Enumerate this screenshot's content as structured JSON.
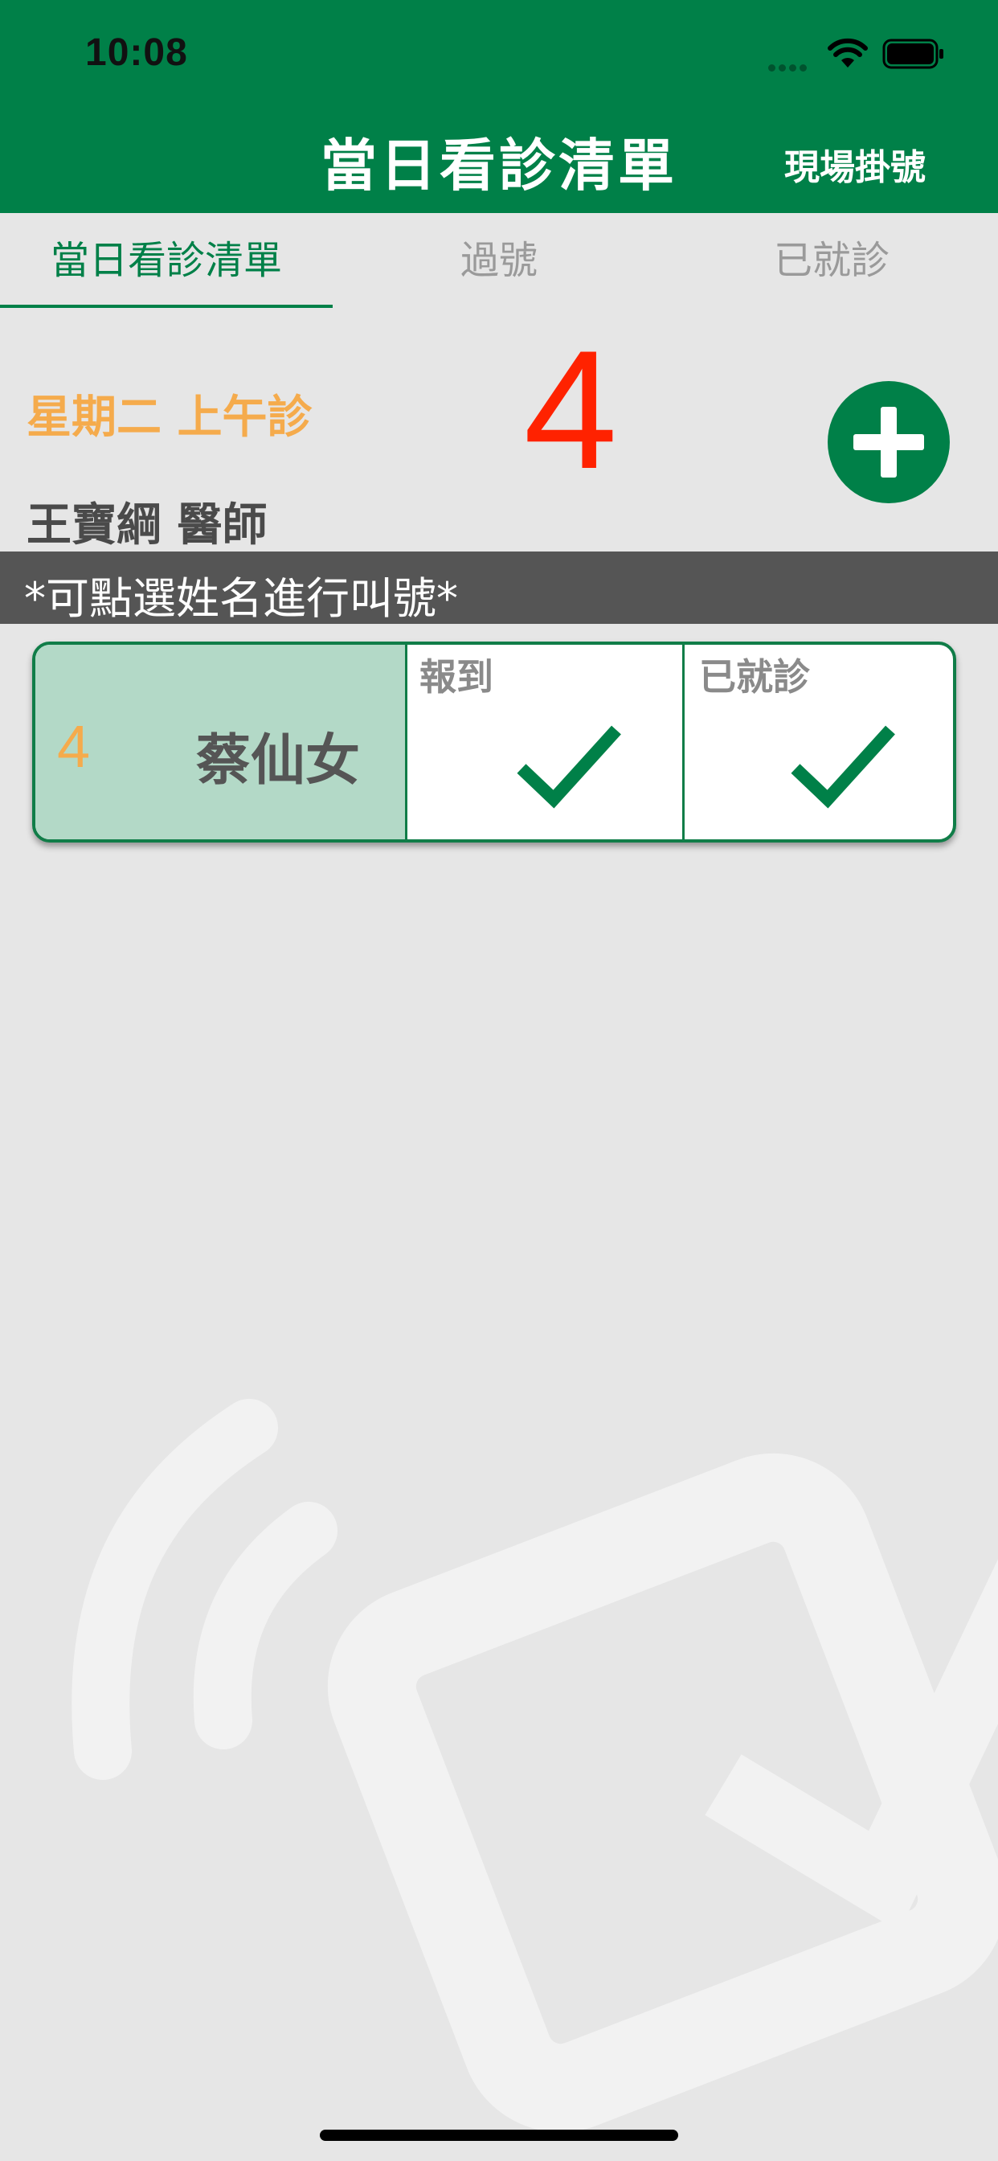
{
  "status_bar": {
    "time": "10:08"
  },
  "nav": {
    "title": "當日看診清單",
    "action_label": "現場掛號"
  },
  "tabs": [
    {
      "label": "當日看診清單",
      "active": true
    },
    {
      "label": "過號",
      "active": false
    },
    {
      "label": "已就診",
      "active": false
    }
  ],
  "session": {
    "label": "星期二 上午診",
    "current_number": "4",
    "doctor": "王寶綱 醫師",
    "hint": "*可點選姓名進行叫號*"
  },
  "patients": [
    {
      "number": "4",
      "name": "蔡仙女",
      "checkin_label": "報到",
      "visited_label": "已就診",
      "checked_in": true,
      "visited": true
    }
  ],
  "colors": {
    "brand_green": "#008048",
    "accent_orange": "#f5ab4c",
    "number_red": "#ff2200",
    "hint_bar": "#555555",
    "card_highlight": "#b3d9c7"
  },
  "icons": {
    "add": "plus-icon",
    "check": "checkmark-icon",
    "wifi": "wifi-icon",
    "battery": "battery-icon"
  }
}
